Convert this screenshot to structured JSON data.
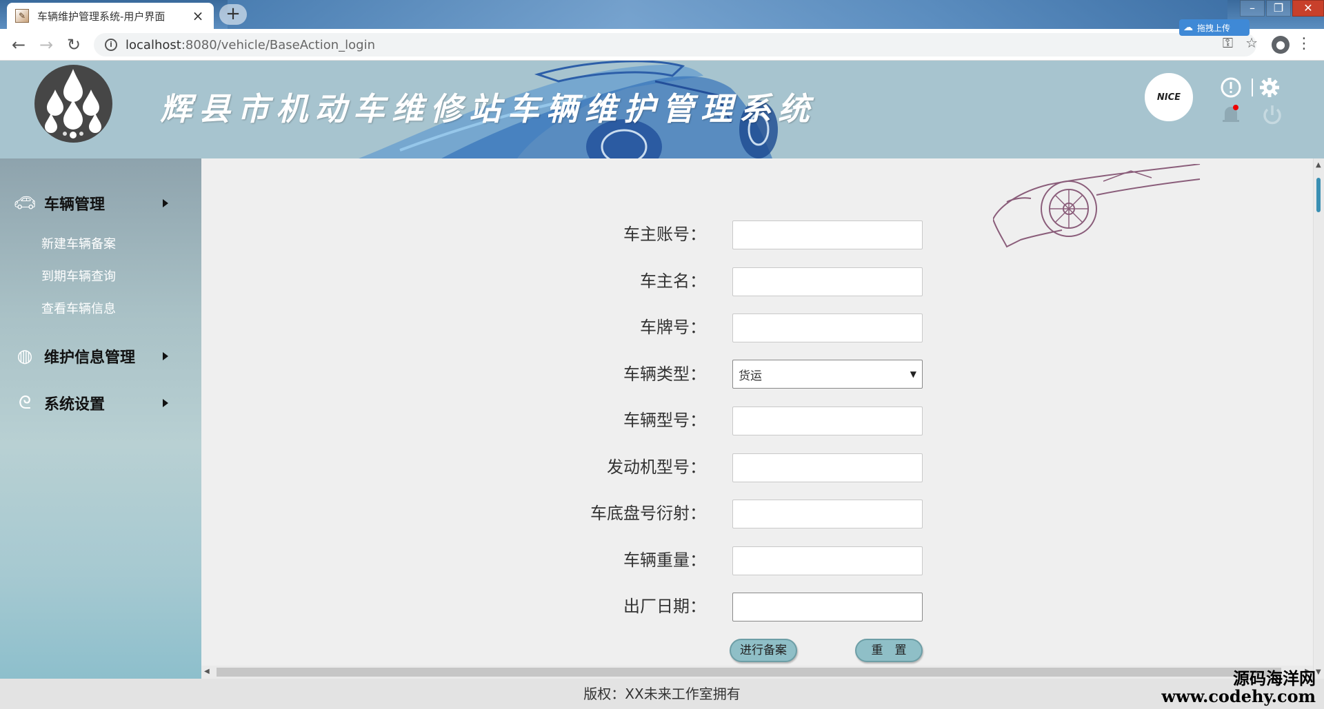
{
  "browser": {
    "tab_title": "车辆维护管理系统-用户界面",
    "url_host": "localhost",
    "url_rest": ":8080/vehicle/BaseAction_login",
    "extension_label": "拖拽上传"
  },
  "header": {
    "system_title": "辉县市机动车维修站车辆维护管理系统",
    "avatar_text": "NICE"
  },
  "sidebar": {
    "groups": [
      {
        "label": "车辆管理",
        "icon": "car-icon"
      },
      {
        "label": "维护信息管理",
        "icon": "globe-icon"
      },
      {
        "label": "系统设置",
        "icon": "swirl-icon"
      }
    ],
    "sub_items": [
      "新建车辆备案",
      "到期车辆查询",
      "查看车辆信息"
    ]
  },
  "form": {
    "labels": [
      "车主账号：",
      "车主名：",
      "车牌号：",
      "车辆类型：",
      "车辆型号：",
      "发动机型号：",
      "车底盘号衍射：",
      "车辆重量：",
      "出厂日期："
    ],
    "vehicle_type_selected": "货运",
    "submit_label": "进行备案",
    "reset_label": "重　置"
  },
  "footer": {
    "copyright": "版权：XX未来工作室拥有"
  },
  "watermark": {
    "line1": "源码海洋网",
    "line2": "www.codehy.com"
  },
  "colors": {
    "header_bg": "#a7c4cf",
    "button_bg": "#8fbfc7",
    "scroll_thumb": "#3a8fb3"
  }
}
